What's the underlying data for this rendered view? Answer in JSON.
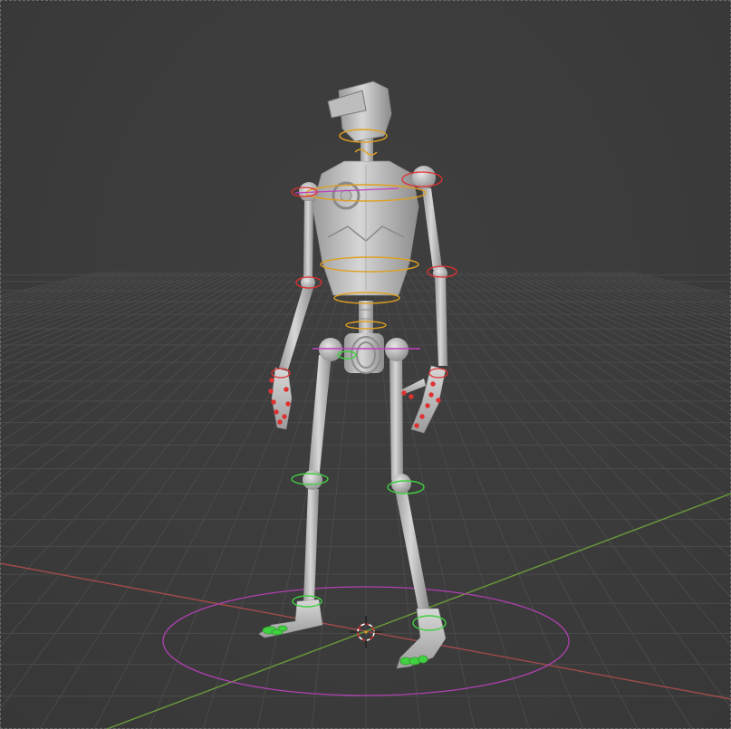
{
  "viewport": {
    "editor": "3D Viewport",
    "background": "#3d3d3d",
    "grid_color": "#4a4a4a",
    "x_axis_color": "#a14b4b",
    "y_axis_color": "#6a9a3a"
  },
  "scene": {
    "object": "robot-armature",
    "bone_colors": {
      "spine": "#e0a020",
      "arms": "#e03030",
      "legs": "#40d040",
      "root": "#c040c0"
    },
    "mesh_color": "#c9c9c9",
    "cursor_icon": "3d-cursor-icon"
  }
}
